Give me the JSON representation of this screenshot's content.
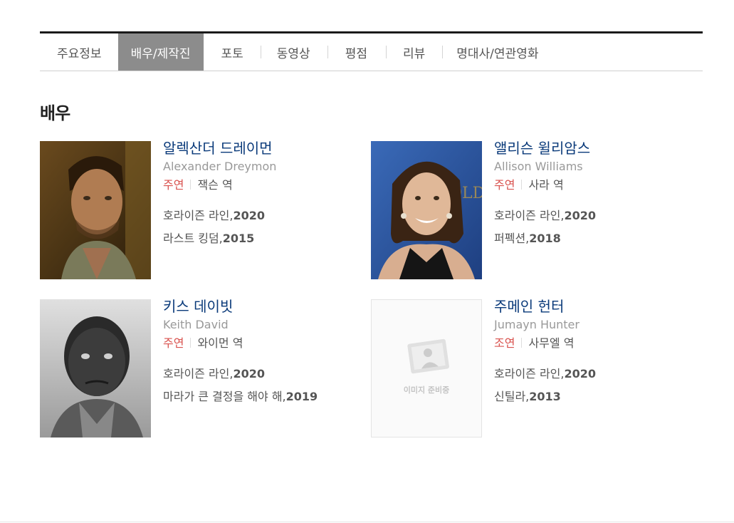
{
  "tabs": [
    {
      "label": "주요정보"
    },
    {
      "label": "배우/제작진"
    },
    {
      "label": "포토"
    },
    {
      "label": "동영상"
    },
    {
      "label": "평점"
    },
    {
      "label": "리뷰"
    },
    {
      "label": "명대사/연관영화"
    }
  ],
  "section_title": "배우",
  "actors": [
    {
      "name_ko": "알렉산더 드레이먼",
      "name_en": "Alexander Dreymon",
      "role_type": "주연",
      "role_name": "잭슨 역",
      "films": [
        {
          "title": "호라이즌 라인,",
          "year": "2020"
        },
        {
          "title": "라스트 킹덤,",
          "year": "2015"
        }
      ]
    },
    {
      "name_ko": "앨리슨 윌리암스",
      "name_en": "Allison Williams",
      "role_type": "주연",
      "role_name": "사라 역",
      "films": [
        {
          "title": "호라이즌 라인,",
          "year": "2020"
        },
        {
          "title": "퍼펙션,",
          "year": "2018"
        }
      ]
    },
    {
      "name_ko": "키스 데이빗",
      "name_en": "Keith David",
      "role_type": "주연",
      "role_name": "와이먼 역",
      "films": [
        {
          "title": "호라이즌 라인,",
          "year": "2020"
        },
        {
          "title": "마라가 큰 결정을 해야 해,",
          "year": "2019"
        }
      ]
    },
    {
      "name_ko": "주메인 헌터",
      "name_en": "Jumayn Hunter",
      "role_type": "조연",
      "role_name": "사무엘 역",
      "films": [
        {
          "title": "호라이즌 라인,",
          "year": "2020"
        },
        {
          "title": "신틸라,",
          "year": "2013"
        }
      ],
      "placeholder_text": "이미지 준비중"
    }
  ],
  "colors": {
    "name": "#0a3a7a",
    "role_type": "#d9534f",
    "active_tab": "#8c8c8c"
  }
}
